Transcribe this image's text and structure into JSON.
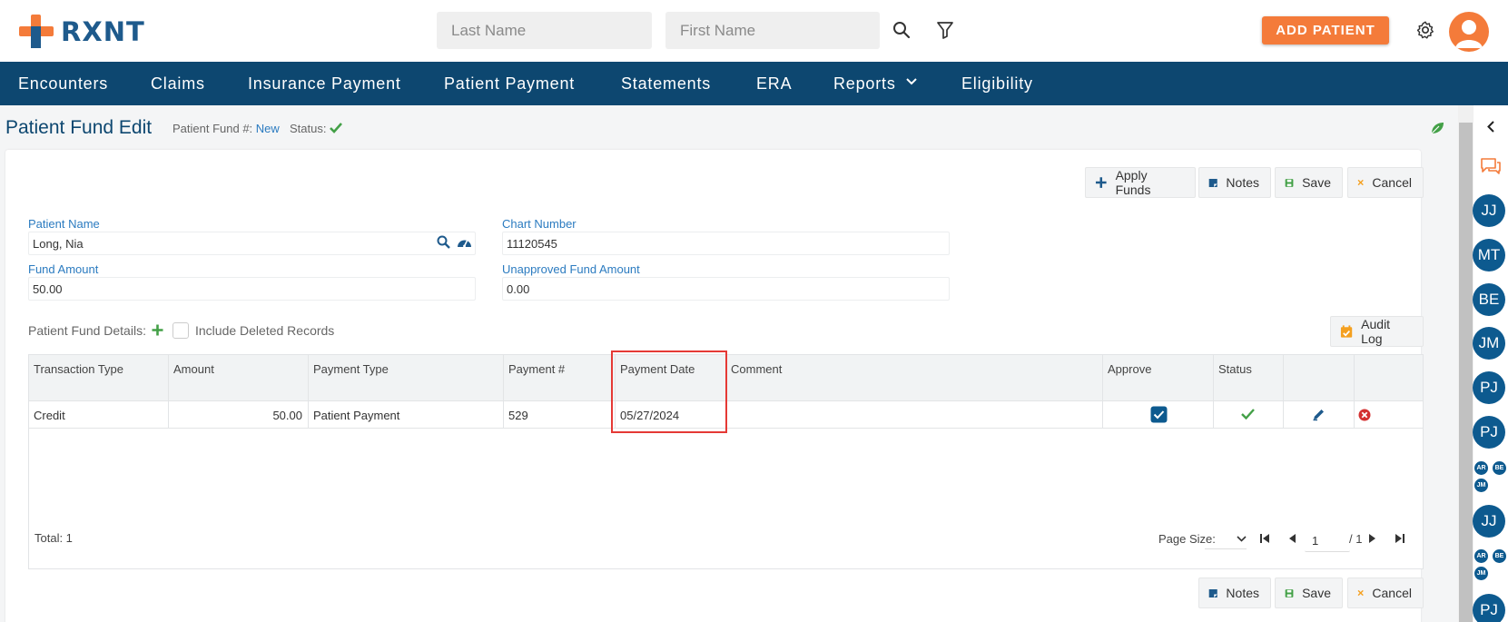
{
  "header": {
    "brand": "RXNT",
    "last_name_placeholder": "Last Name",
    "first_name_placeholder": "First Name",
    "add_patient_label": "ADD PATIENT"
  },
  "nav": {
    "items": [
      "Encounters",
      "Claims",
      "Insurance Payment",
      "Patient Payment",
      "Statements",
      "ERA",
      "Reports",
      "Eligibility"
    ]
  },
  "page": {
    "title": "Patient Fund Edit",
    "fund_no_label": "Patient Fund #:",
    "fund_no_value": "New",
    "status_label": "Status:"
  },
  "toolbar": {
    "apply_funds": "Apply Funds",
    "notes": "Notes",
    "save": "Save",
    "cancel": "Cancel",
    "audit_log": "Audit Log"
  },
  "form": {
    "patient_name_label": "Patient Name",
    "patient_name_value": "Long, Nia",
    "chart_number_label": "Chart Number",
    "chart_number_value": "11120545",
    "fund_amount_label": "Fund Amount",
    "fund_amount_value": "50.00",
    "unapproved_label": "Unapproved Fund Amount",
    "unapproved_value": "0.00"
  },
  "details": {
    "label": "Patient Fund Details:",
    "include_deleted": "Include Deleted Records"
  },
  "grid": {
    "headers": {
      "transaction_type": "Transaction Type",
      "amount": "Amount",
      "payment_type": "Payment Type",
      "payment_no": "Payment #",
      "payment_date": "Payment Date",
      "comment": "Comment",
      "approve": "Approve",
      "status": "Status"
    },
    "rows": [
      {
        "transaction_type": "Credit",
        "amount": "50.00",
        "payment_type": "Patient Payment",
        "payment_no": "529",
        "payment_date": "05/27/2024",
        "comment": ""
      }
    ],
    "total_label": "Total: 1",
    "page_size_label": "Page Size:",
    "page_value": "1",
    "page_of": "/ 1"
  },
  "rail": {
    "users": [
      "JJ",
      "MT",
      "BE",
      "JM",
      "PJ",
      "PJ"
    ],
    "group1": [
      "AR",
      "BE",
      "JM"
    ],
    "user7": "JJ",
    "group2": [
      "AR",
      "BE",
      "JM"
    ],
    "user8": "PJ"
  },
  "colors": {
    "brand_blue": "#0d4770",
    "accent_orange": "#f47b3a",
    "link_blue": "#2b7bc0",
    "success_green": "#43a047",
    "danger_red": "#d32f2f"
  }
}
